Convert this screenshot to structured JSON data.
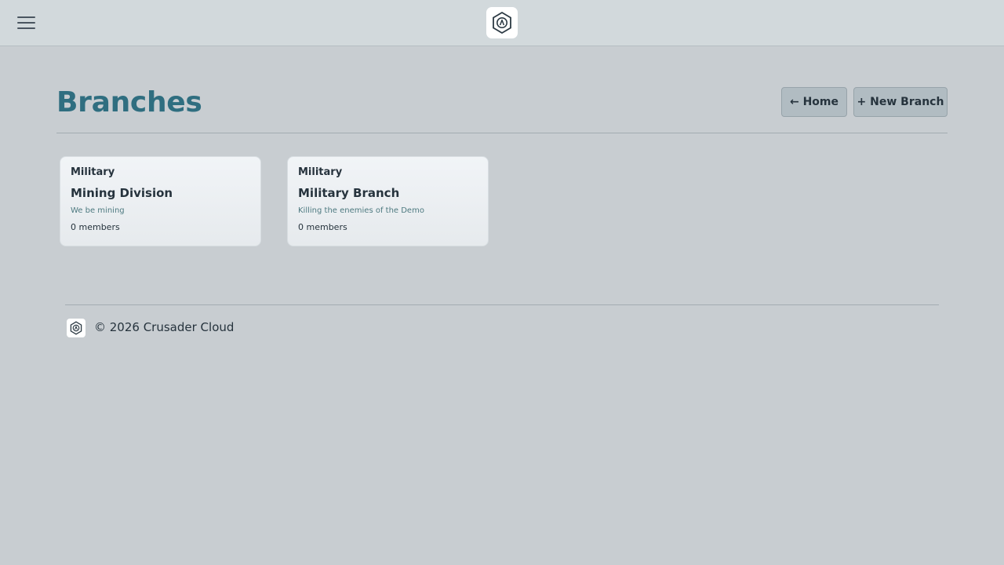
{
  "header": {
    "menu_icon": "hamburger-icon",
    "logo_icon": "hexagon-logo-icon"
  },
  "page": {
    "title": "Branches",
    "home_button": "← Home",
    "new_branch_button": "+ New Branch"
  },
  "branches": [
    {
      "type": "Military",
      "name": "Mining Division",
      "description": "We be mining",
      "members": "0 members"
    },
    {
      "type": "Military",
      "name": "Military Branch",
      "description": "Killing the enemies of the Demo",
      "members": "0 members"
    }
  ],
  "footer": {
    "logo_icon": "hexagon-logo-icon",
    "copyright": "© 2026 Crusader Cloud"
  },
  "colors": {
    "background": "#c8cdd1",
    "title": "#2f6e80",
    "button": "#b1bcc2"
  }
}
